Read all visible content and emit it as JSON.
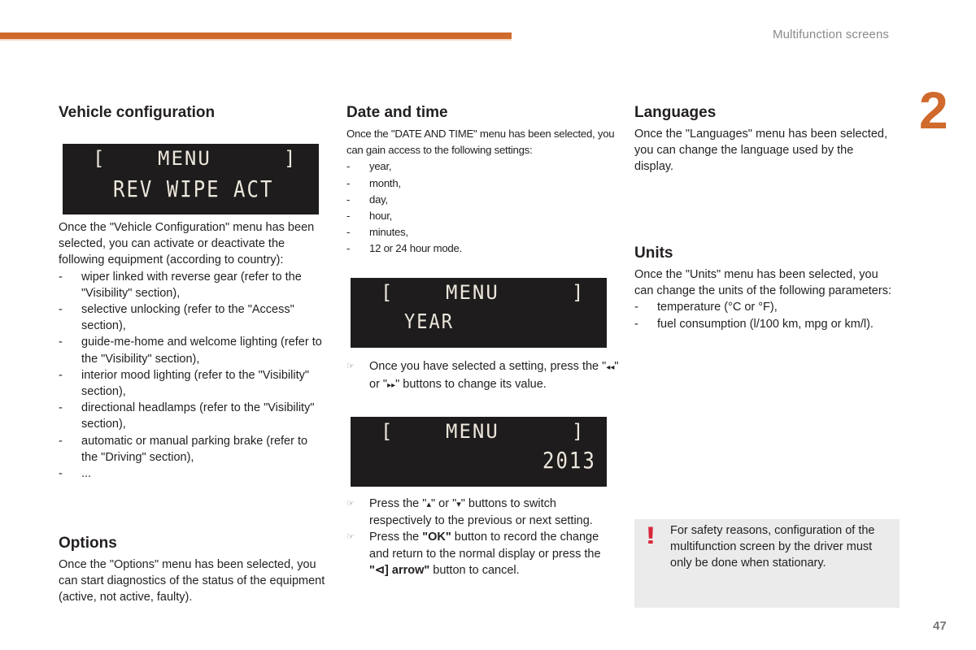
{
  "header": {
    "section_title": "Multifunction screens",
    "chapter_number": "2",
    "accent_color": "#cf6a2c"
  },
  "page_number": "47",
  "vehicle_configuration": {
    "title": "Vehicle configuration",
    "display": {
      "bracket_left": "[",
      "menu": "MENU",
      "bracket_right": "]",
      "line2": "REV WIPE ACT"
    },
    "intro": "Once the \"Vehicle Configuration\" menu has been selected, you can activate or deactivate the following equipment (according to country):",
    "items": [
      "wiper linked with reverse gear (refer to the \"Visibility\" section),",
      "selective unlocking (refer to the \"Access\" section),",
      "guide-me-home and welcome lighting (refer to the \"Visibility\" section),",
      "interior mood lighting (refer to the \"Visibility\" section),",
      "directional headlamps (refer to the \"Visibility\" section),",
      "automatic or manual parking brake (refer to the \"Driving\" section),",
      "..."
    ]
  },
  "options": {
    "title": "Options",
    "text": "Once the \"Options\" menu has been selected, you can start diagnostics of the status of the equipment (active, not active, faulty)."
  },
  "date_and_time": {
    "title": "Date and time",
    "intro": "Once the \"DATE AND TIME\" menu has been selected, you can gain access to the following settings:",
    "items": [
      "year,",
      "month,",
      "day,",
      "hour,",
      "minutes,",
      "12 or 24 hour mode."
    ],
    "display_year": {
      "bracket_left": "[",
      "menu": "MENU",
      "bracket_right": "]",
      "line2": "YEAR"
    },
    "note1_part1": "Once you have selected a setting, press the \"",
    "note1_icon_prev": "◂◂",
    "note1_part2": "\" or \"",
    "note1_icon_next": "▸▸",
    "note1_part3": "\" buttons to change its value.",
    "display_value": {
      "bracket_left": "[",
      "menu": "MENU",
      "bracket_right": "]",
      "line2": "2013"
    },
    "note2_part1": "Press the \"",
    "note2_icon_up": "▴",
    "note2_part2": "\" or \"",
    "note2_icon_down": "▾",
    "note2_part3": "\" buttons to switch respectively to the previous or next setting.",
    "note3_part1": "Press the ",
    "note3_bold1": "\"OK\"",
    "note3_part2": " button to record the change and return to the normal display or press the ",
    "note3_bold2": "\"⊲] arrow\"",
    "note3_part3": " button to cancel.",
    "pointer_glyph": "☞"
  },
  "languages": {
    "title": "Languages",
    "text": "Once the \"Languages\" menu has been selected, you can change the language used by the display."
  },
  "units": {
    "title": "Units",
    "intro": "Once the \"Units\" menu has been selected, you can change the units of the following parameters:",
    "items": [
      "temperature (°C or °F),",
      "fuel consumption (l/100 km, mpg or km/l)."
    ]
  },
  "warning": {
    "icon": "!",
    "icon_color": "#d8263a",
    "text": "For safety reasons, configuration of the multifunction screen by the driver must only be done when stationary."
  },
  "dash": "-"
}
